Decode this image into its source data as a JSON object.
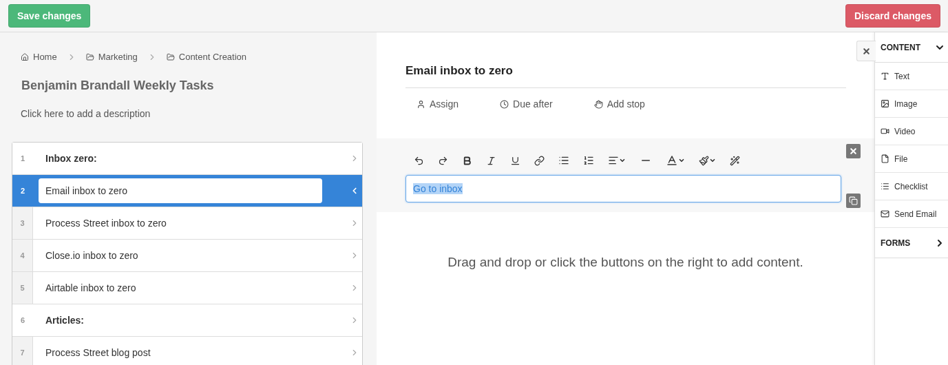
{
  "top_bar": {
    "save_button": "Save changes",
    "discard_button": "Discard changes"
  },
  "breadcrumb": [
    {
      "kind": "home",
      "label": "Home"
    },
    {
      "kind": "folder",
      "label": "Marketing"
    },
    {
      "kind": "folder",
      "label": "Content Creation"
    }
  ],
  "checklist": {
    "title": "Benjamin Brandall Weekly Tasks",
    "description": "Click here to add a description"
  },
  "tasks": [
    {
      "number": "1",
      "label": "Inbox zero:",
      "kind": "heading",
      "selected": false
    },
    {
      "number": "2",
      "label": "Email inbox to zero",
      "kind": "task",
      "selected": true
    },
    {
      "number": "3",
      "label": "Process Street inbox to zero",
      "kind": "task",
      "selected": false
    },
    {
      "number": "4",
      "label": "Close.io inbox to zero",
      "kind": "task",
      "selected": false
    },
    {
      "number": "5",
      "label": "Airtable inbox to zero",
      "kind": "task",
      "selected": false
    },
    {
      "number": "6",
      "label": "Articles:",
      "kind": "heading",
      "selected": false
    },
    {
      "number": "7",
      "label": "Process Street blog post",
      "kind": "task",
      "selected": false
    }
  ],
  "task_detail": {
    "title": "Email inbox to zero",
    "actions": [
      {
        "kind": "assign",
        "label": "Assign"
      },
      {
        "kind": "due",
        "label": "Due after"
      },
      {
        "kind": "stop",
        "label": "Add stop"
      }
    ],
    "editor_value": "Go to inbox",
    "empty_hint": "Drag and drop or click the buttons on the right to add content."
  },
  "sidebar": {
    "sections": [
      {
        "label": "CONTENT",
        "expanded": true,
        "items": [
          {
            "kind": "text",
            "label": "Text"
          },
          {
            "kind": "image",
            "label": "Image"
          },
          {
            "kind": "video",
            "label": "Video"
          },
          {
            "kind": "file",
            "label": "File"
          },
          {
            "kind": "checklist",
            "label": "Checklist"
          },
          {
            "kind": "email",
            "label": "Send Email"
          }
        ]
      },
      {
        "label": "FORMS",
        "expanded": false
      }
    ]
  }
}
